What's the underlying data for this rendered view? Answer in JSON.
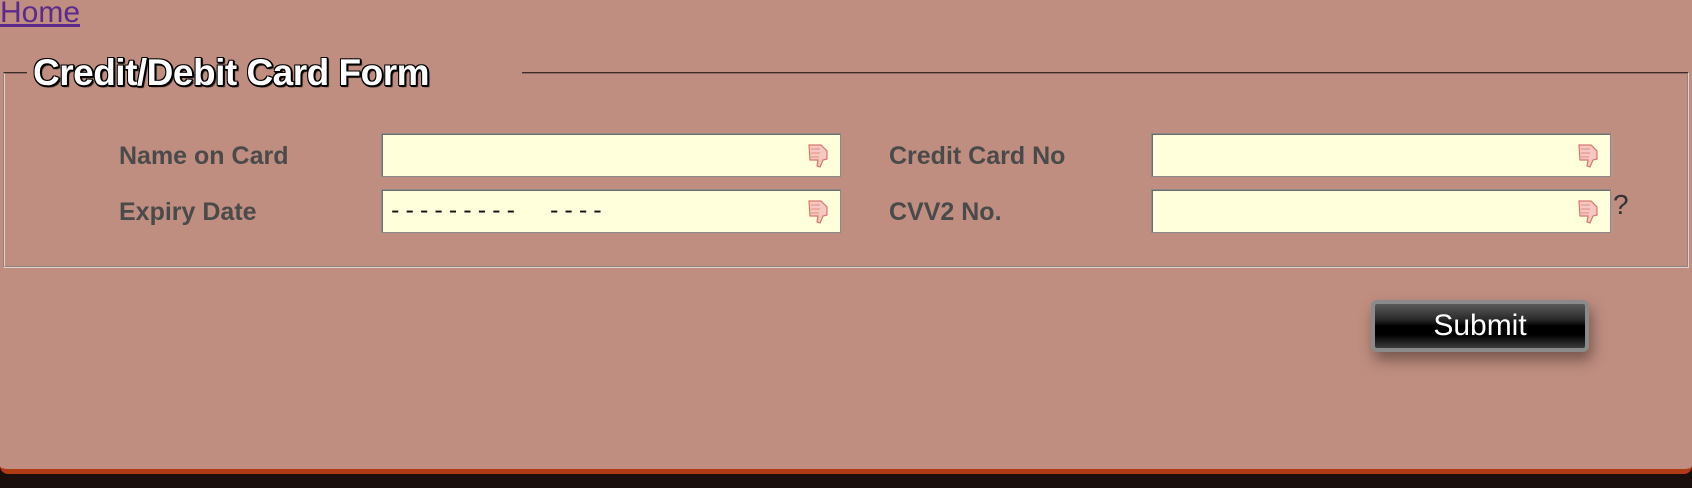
{
  "nav": {
    "home_label": "Home"
  },
  "form": {
    "legend": "Credit/Debit Card Form",
    "fields": {
      "name_on_card": {
        "label": "Name on Card",
        "value": ""
      },
      "credit_card_no": {
        "label": "Credit Card No",
        "value": ""
      },
      "expiry_date": {
        "label": "Expiry Date",
        "value": "---------  ----"
      },
      "cvv2_no": {
        "label": "CVV2 No.",
        "value": "",
        "help": "?"
      }
    },
    "submit_label": "Submit"
  },
  "icons": {
    "field_status": "thumbs-down-icon"
  },
  "colors": {
    "background": "#bf8e80",
    "field_background": "#ffffdc",
    "link": "#5b2a8c",
    "bottom_border": "#b03a14"
  }
}
